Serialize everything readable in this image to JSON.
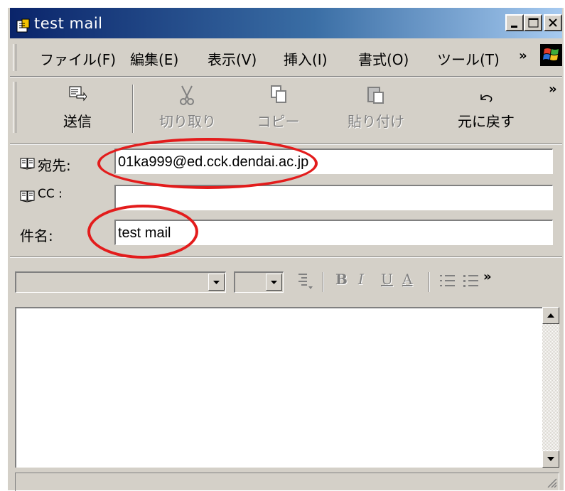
{
  "window": {
    "title": "test mail"
  },
  "menubar": {
    "items": [
      "ファイル(F)",
      "編集(E)",
      "表示(V)",
      "挿入(I)",
      "書式(O)",
      "ツール(T)"
    ],
    "overflow": "»"
  },
  "toolbar": {
    "send": "送信",
    "cut": "切り取り",
    "copy": "コピー",
    "paste": "貼り付け",
    "undo": "元に戻す",
    "overflow": "»"
  },
  "fields": {
    "to_label": "宛先:",
    "to_value": "01ka999@ed.cck.dendai.ac.jp",
    "cc_label": "CC :",
    "cc_value": "",
    "subject_label": "件名:",
    "subject_value": "test mail"
  },
  "format_toolbar": {
    "bold": "B",
    "italic": "I",
    "underline": "U",
    "font_color": "A",
    "overflow": "»"
  },
  "colors": {
    "title_start": "#0a246a",
    "title_end": "#a6caf0",
    "face": "#d4d0c8",
    "annotation": "#e31c1c"
  }
}
